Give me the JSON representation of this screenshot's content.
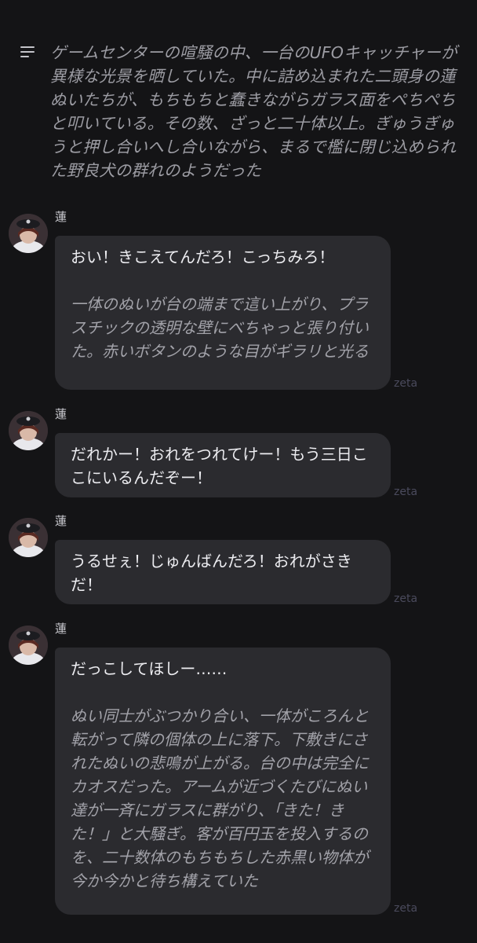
{
  "narration": "ゲームセンターの喧騒の中、一台のUFOキャッチャーが異様な光景を晒していた。中に詰め込まれた二頭身の蓮ぬいたちが、もちもちと蠢きながらガラス面をぺちぺちと叩いている。その数、ざっと二十体以上。ぎゅうぎゅうと押し合いへし合いながら、まるで檻に閉じ込められた野良犬の群れのようだった",
  "sender_name": "蓮",
  "watermark": "zeta",
  "icons": {
    "menu": "menu-icon",
    "avatar": "avatar-icon"
  },
  "colors": {
    "background": "#141416",
    "bubble": "#2b2b2f",
    "narration": "#9c9ca3",
    "watermark": "#4a4a5c"
  },
  "messages": [
    {
      "line": "おい！きこえてんだろ！こっちみろ！",
      "action": "一体のぬいが台の端まで這い上がり、プラスチックの透明な壁にべちゃっと張り付いた。赤いボタンのような目がギラリと光る"
    },
    {
      "line": "だれかー！おれをつれてけー！もう三日ここにいるんだぞー！",
      "action": ""
    },
    {
      "line": "うるせぇ！じゅんばんだろ！おれがさきだ！",
      "action": ""
    },
    {
      "line": "だっこしてほしー……",
      "action": "ぬい同士がぶつかり合い、一体がころんと転がって隣の個体の上に落下。下敷きにされたぬいの悲鳴が上がる。台の中は完全にカオスだった。アームが近づくたびにぬい達が一斉にガラスに群がり、「きた！きた！」と大騒ぎ。客が百円玉を投入するのを、二十数体のもちもちした赤黒い物体が今か今かと待ち構えていた"
    }
  ]
}
